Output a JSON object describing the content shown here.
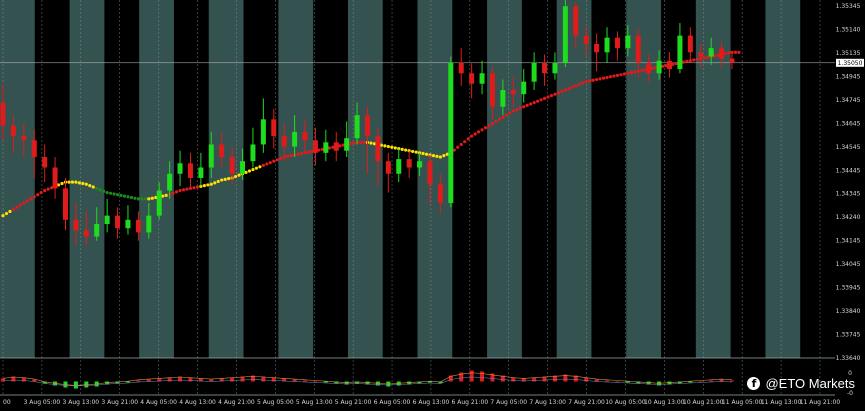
{
  "chart_data": {
    "type": "candlestick",
    "grid": true,
    "price_axis": {
      "tick_labels": [
        "1.35345",
        "1.35140",
        "1.35135",
        "1.34945",
        "1.34745",
        "1.34645",
        "1.34545",
        "1.34445",
        "1.34345",
        "1.34240",
        "1.34145",
        "1.34045",
        "1.33945",
        "1.33840",
        "1.33745",
        "1.33640"
      ],
      "current_price": "1.35050"
    },
    "time_axis": {
      "tick_labels": [
        "00",
        "3 Aug 05:00",
        "3 Aug 13:00",
        "3 Aug 21:00",
        "4 Aug 05:00",
        "4 Aug 13:00",
        "4 Aug 21:00",
        "5 Aug 05:00",
        "5 Aug 13:00",
        "5 Aug 21:00",
        "6 Aug 05:00",
        "6 Aug 13:00",
        "6 Aug 21:00",
        "7 Aug 05:00",
        "7 Aug 13:00",
        "7 Aug 21:00",
        "10 Aug 05:00",
        "10 Aug 13:00",
        "10 Aug 21:00",
        "11 Aug 05:00",
        "11 Aug 13:00",
        "11 Aug 21:00"
      ]
    },
    "candles": [
      [
        1.3486,
        1.3475,
        1.3495,
        1.3468
      ],
      [
        1.3475,
        1.347,
        1.348,
        1.3462
      ],
      [
        1.347,
        1.3468,
        1.3476,
        1.346
      ],
      [
        1.3468,
        1.346,
        1.3473,
        1.345
      ],
      [
        1.346,
        1.3455,
        1.3466,
        1.3448
      ],
      [
        1.3455,
        1.3445,
        1.346,
        1.344
      ],
      [
        1.3445,
        1.343,
        1.345,
        1.3425
      ],
      [
        1.343,
        1.3425,
        1.3438,
        1.3418
      ],
      [
        1.3425,
        1.3422,
        1.3434,
        1.3418
      ],
      [
        1.3422,
        1.3428,
        1.3436,
        1.342
      ],
      [
        1.3428,
        1.3432,
        1.344,
        1.3424
      ],
      [
        1.3432,
        1.3426,
        1.3436,
        1.3421
      ],
      [
        1.3426,
        1.343,
        1.3437,
        1.3423
      ],
      [
        1.343,
        1.3424,
        1.3434,
        1.342
      ],
      [
        1.3424,
        1.3432,
        1.3438,
        1.3421
      ],
      [
        1.3432,
        1.3444,
        1.3448,
        1.343
      ],
      [
        1.3444,
        1.3452,
        1.3458,
        1.344
      ],
      [
        1.3452,
        1.3457,
        1.3463,
        1.3446
      ],
      [
        1.3457,
        1.345,
        1.3462,
        1.3445
      ],
      [
        1.345,
        1.3455,
        1.3462,
        1.3446
      ],
      [
        1.3455,
        1.3466,
        1.3472,
        1.345
      ],
      [
        1.3466,
        1.346,
        1.3472,
        1.3455
      ],
      [
        1.346,
        1.3452,
        1.3465,
        1.3447
      ],
      [
        1.3452,
        1.3458,
        1.3464,
        1.3449
      ],
      [
        1.3458,
        1.3466,
        1.3474,
        1.3455
      ],
      [
        1.3466,
        1.3478,
        1.3488,
        1.3462
      ],
      [
        1.3478,
        1.347,
        1.3483,
        1.3464
      ],
      [
        1.347,
        1.3465,
        1.3476,
        1.3458
      ],
      [
        1.3465,
        1.3472,
        1.348,
        1.346
      ],
      [
        1.3472,
        1.3468,
        1.3478,
        1.3462
      ],
      [
        1.3468,
        1.3462,
        1.3474,
        1.3456
      ],
      [
        1.3462,
        1.3467,
        1.3473,
        1.3458
      ],
      [
        1.3467,
        1.3463,
        1.3472,
        1.3458
      ],
      [
        1.3463,
        1.3469,
        1.3477,
        1.346
      ],
      [
        1.3469,
        1.348,
        1.3486,
        1.3466
      ],
      [
        1.348,
        1.347,
        1.3484,
        1.3452
      ],
      [
        1.347,
        1.3458,
        1.3474,
        1.3446
      ],
      [
        1.3458,
        1.3452,
        1.3462,
        1.3443
      ],
      [
        1.3452,
        1.3459,
        1.3464,
        1.3448
      ],
      [
        1.3459,
        1.3455,
        1.3463,
        1.345
      ],
      [
        1.3455,
        1.3458,
        1.3462,
        1.3451
      ],
      [
        1.3458,
        1.3447,
        1.3461,
        1.3437
      ],
      [
        1.3447,
        1.3438,
        1.3452,
        1.3433
      ],
      [
        1.3438,
        1.3505,
        1.3508,
        1.3436
      ],
      [
        1.3505,
        1.35,
        1.3512,
        1.3494
      ],
      [
        1.35,
        1.3495,
        1.3505,
        1.3488
      ],
      [
        1.3495,
        1.35,
        1.3506,
        1.349
      ],
      [
        1.35,
        1.3484,
        1.3503,
        1.3478
      ],
      [
        1.3484,
        1.3492,
        1.3497,
        1.348
      ],
      [
        1.3492,
        1.349,
        1.3498,
        1.3484
      ],
      [
        1.349,
        1.3496,
        1.3502,
        1.3486
      ],
      [
        1.3496,
        1.3505,
        1.351,
        1.3492
      ],
      [
        1.3505,
        1.35,
        1.3509,
        1.3494
      ],
      [
        1.35,
        1.3505,
        1.351,
        1.3497
      ],
      [
        1.3505,
        1.3532,
        1.3538,
        1.3503
      ],
      [
        1.3532,
        1.3518,
        1.3534,
        1.3512
      ],
      [
        1.3518,
        1.3514,
        1.3522,
        1.3508
      ],
      [
        1.3514,
        1.351,
        1.3519,
        1.3501
      ],
      [
        1.351,
        1.3517,
        1.3522,
        1.3505
      ],
      [
        1.3517,
        1.3512,
        1.352,
        1.3506
      ],
      [
        1.3512,
        1.3518,
        1.3523,
        1.3508
      ],
      [
        1.3518,
        1.3505,
        1.3521,
        1.3498
      ],
      [
        1.3505,
        1.35,
        1.3509,
        1.3496
      ],
      [
        1.35,
        1.3506,
        1.3511,
        1.3497
      ],
      [
        1.3506,
        1.3502,
        1.351,
        1.3498
      ],
      [
        1.3502,
        1.3518,
        1.3524,
        1.35
      ],
      [
        1.3518,
        1.351,
        1.3522,
        1.3505
      ],
      [
        1.351,
        1.3508,
        1.3514,
        1.3503
      ],
      [
        1.3508,
        1.3512,
        1.3517,
        1.3504
      ],
      [
        1.3512,
        1.3507,
        1.3515,
        1.3503
      ],
      [
        1.3507,
        1.3505,
        1.351,
        1.3502
      ]
    ],
    "moving_average": [
      1.3432,
      1.3435,
      1.3438,
      1.3441,
      1.3444,
      1.3446,
      1.3448,
      1.3448,
      1.3447,
      1.3445,
      1.3443,
      1.3442,
      1.3441,
      1.344,
      1.344,
      1.3441,
      1.3442,
      1.3444,
      1.3445,
      1.3446,
      1.3447,
      1.3449,
      1.345,
      1.3452,
      1.3454,
      1.3456,
      1.3458,
      1.346,
      1.3461,
      1.3462,
      1.3463,
      1.3464,
      1.3465,
      1.3466,
      1.3467,
      1.3467,
      1.3466,
      1.3465,
      1.3464,
      1.3463,
      1.3462,
      1.3461,
      1.346,
      1.3462,
      1.3466,
      1.347,
      1.3473,
      1.3476,
      1.3479,
      1.3482,
      1.3484,
      1.3486,
      1.3488,
      1.349,
      1.3492,
      1.3494,
      1.3496,
      1.3497,
      1.3498,
      1.3499,
      1.35,
      1.3501,
      1.3502,
      1.3503,
      1.3504,
      1.3505,
      1.3506,
      1.3507,
      1.3508,
      1.3509,
      1.351
    ],
    "moving_average_colors": {
      "uptrend": "#e01b1b",
      "flat": "#ffe000",
      "downtrend": "#1e8a1e"
    },
    "candle_colors": {
      "bull": "#1edc1e",
      "bear": "#e01b1b"
    },
    "session_colors": {
      "active": "#345250",
      "inactive": "#000000"
    },
    "oscillator": {
      "values": [
        0.3,
        0.5,
        0.4,
        0.2,
        -0.2,
        -0.4,
        -0.6,
        -0.7,
        -0.6,
        -0.5,
        -0.3,
        -0.2,
        -0.1,
        0.1,
        0.2,
        0.3,
        0.4,
        0.5,
        0.4,
        0.3,
        0.2,
        0.3,
        0.4,
        0.5,
        0.6,
        0.5,
        0.4,
        0.3,
        0.2,
        0.1,
        0.0,
        -0.1,
        -0.2,
        -0.3,
        -0.2,
        -0.3,
        -0.4,
        -0.5,
        -0.4,
        -0.3,
        -0.2,
        -0.1,
        -0.2,
        0.6,
        0.9,
        1.1,
        1.0,
        0.8,
        0.6,
        0.4,
        0.3,
        0.4,
        0.5,
        0.6,
        0.7,
        0.6,
        0.4,
        0.2,
        0.1,
        0.0,
        -0.1,
        -0.2,
        -0.3,
        -0.4,
        -0.3,
        -0.2,
        -0.1,
        0.0,
        0.1,
        0.2,
        0.1
      ],
      "axis_labels": [
        "0",
        "-0"
      ]
    }
  },
  "watermark": {
    "icon": "facebook-icon",
    "text": "@ETO Markets"
  }
}
